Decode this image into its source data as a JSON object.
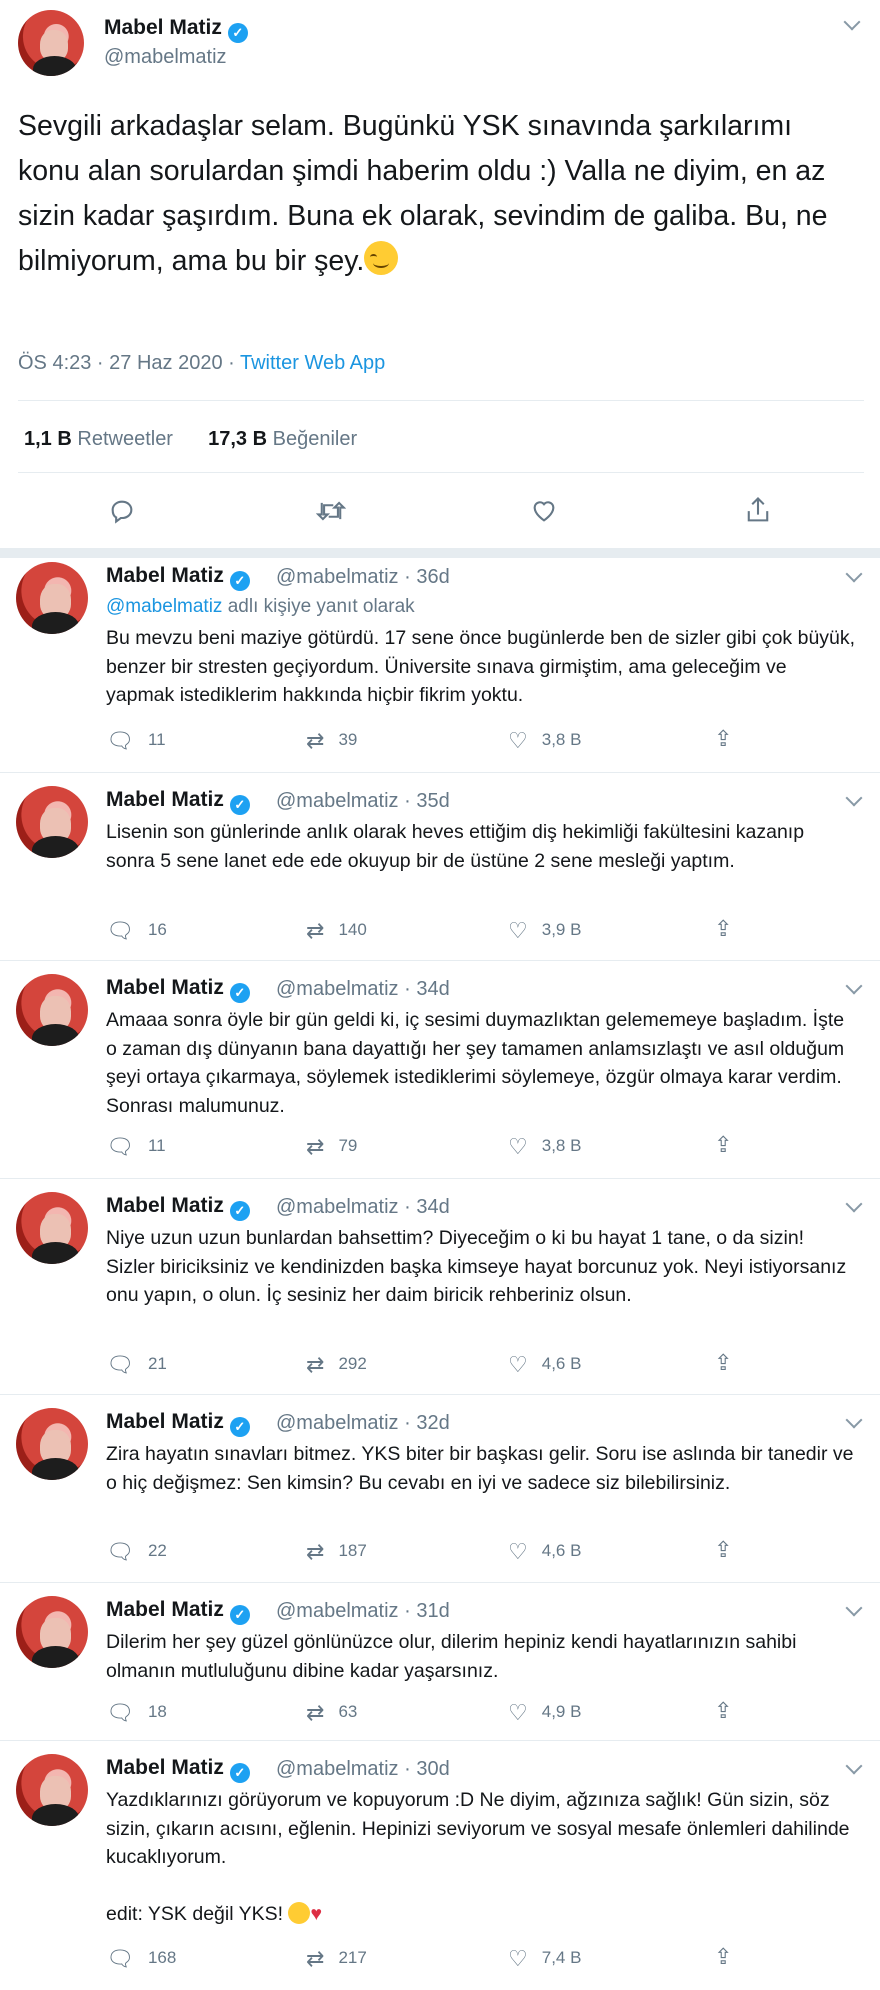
{
  "main_tweet": {
    "name": "Mabel Matiz",
    "handle": "@mabelmatiz",
    "text": "Sevgili arkadaşlar selam. Bugünkü YSK sınavında şarkılarımı konu alan sorulardan şimdi haberim oldu :) Valla ne diyim, en az sizin kadar şaşırdım. Buna ek olarak, sevindim de galiba. Bu, ne bilmiyorum, ama bu bir şey.",
    "timestamp": "ÖS 4:23 · 27 Haz 2020 · ",
    "source": "Twitter Web App",
    "retweets_count": "1,1 B",
    "retweets_label": "Retweetler",
    "likes_count": "17,3 B",
    "likes_label": "Beğeniler"
  },
  "replies": [
    {
      "name": "Mabel Matiz",
      "handle": "@mabelmatiz · 36d",
      "reply_to_handle": "@mabelmatiz",
      "reply_to_text": " adlı kişiye yanıt olarak",
      "text": "Bu mevzu beni maziye götürdü. 17 sene önce bugünlerde ben de sizler gibi çok büyük, benzer bir stresten geçiyordum. Üniversite sınava girmiştim, ama geleceğim ve yapmak istediklerim hakkında hiçbir fikrim yoktu.",
      "replies": "11",
      "retweets": "39",
      "likes": "3,8 B"
    },
    {
      "name": "Mabel Matiz",
      "handle": "@mabelmatiz · 35d",
      "text": "Lisenin son günlerinde anlık olarak heves ettiğim diş hekimliği fakültesini kazanıp sonra 5 sene lanet ede ede okuyup bir de üstüne 2 sene mesleği yaptım.",
      "replies": "16",
      "retweets": "140",
      "likes": "3,9 B"
    },
    {
      "name": "Mabel Matiz",
      "handle": "@mabelmatiz · 34d",
      "text": "Amaaa sonra öyle bir gün geldi ki, iç sesimi duymazlıktan gelememeye başladım. İşte o zaman dış dünyanın bana dayattığı her şey tamamen anlamsızlaştı ve asıl olduğum şeyi ortaya çıkarmaya, söylemek istediklerimi söylemeye, özgür olmaya karar verdim. Sonrası malumunuz.",
      "replies": "11",
      "retweets": "79",
      "likes": "3,8 B"
    },
    {
      "name": "Mabel Matiz",
      "handle": "@mabelmatiz · 34d",
      "text": "Niye uzun uzun bunlardan bahsettim? Diyeceğim o ki bu hayat 1 tane, o da sizin! Sizler biriciksiniz ve kendinizden başka kimseye hayat borcunuz yok. Neyi istiyorsanız onu yapın, o olun. İç sesiniz her daim biricik rehberiniz olsun.",
      "replies": "21",
      "retweets": "292",
      "likes": "4,6 B"
    },
    {
      "name": "Mabel Matiz",
      "handle": "@mabelmatiz · 32d",
      "text": "Zira hayatın sınavları bitmez. YKS biter bir başkası gelir. Soru ise aslında bir tanedir ve o hiç değişmez: Sen kimsin? Bu cevabı en iyi ve sadece siz bilebilirsiniz.",
      "replies": "22",
      "retweets": "187",
      "likes": "4,6 B"
    },
    {
      "name": "Mabel Matiz",
      "handle": "@mabelmatiz · 31d",
      "text": "Dilerim her şey güzel gönlünüzce olur, dilerim hepiniz kendi hayatlarınızın sahibi olmanın mutluluğunu dibine kadar yaşarsınız.",
      "replies": "18",
      "retweets": "63",
      "likes": "4,9 B"
    },
    {
      "name": "Mabel Matiz",
      "handle": "@mabelmatiz · 30d",
      "text": "Yazdıklarınızı görüyorum ve kopuyorum :D Ne diyim, ağzınıza sağlık! Gün sizin, söz sizin, çıkarın acısını, eğlenin. Hepinizi seviyorum ve sosyal mesafe önlemleri dahilinde kucaklıyorum.",
      "edit_text": "edit: YSK değil YKS!",
      "replies": "168",
      "retweets": "217",
      "likes": "7,4 B"
    }
  ]
}
